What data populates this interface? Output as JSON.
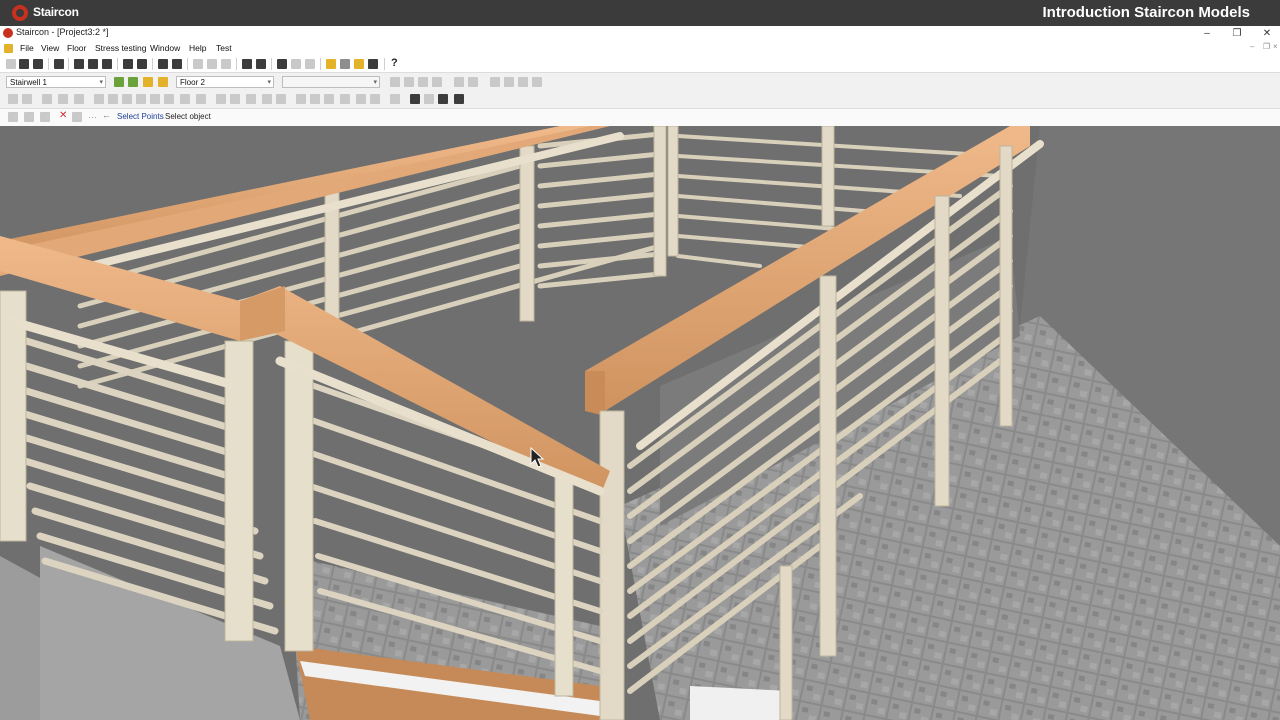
{
  "video": {
    "brand": "Staircon",
    "title": "Introduction Staircon Models"
  },
  "window": {
    "title": "Staircon - [Project3:2 *]",
    "minimize": "–",
    "restore": "❐",
    "close": "✕"
  },
  "menu": {
    "items": [
      "File",
      "View",
      "Floor",
      "Stress testing",
      "Window",
      "Help",
      "Test"
    ]
  },
  "toolbar": {
    "stairwell_select": "Stairwell 1",
    "floor_select": "Floor 2",
    "empty_select": ""
  },
  "status": {
    "select_points": "Select Points",
    "select_object": "Select object"
  },
  "icons": {
    "logo": "staircon-logo-icon",
    "help": "help-icon",
    "undo": "undo-icon",
    "redo": "redo-icon",
    "zoom": "zoom-icon",
    "cancel": "cancel-icon"
  },
  "colors": {
    "handrail": "#e0a774",
    "post": "#d9d1bd",
    "floor": "#7a7a7a",
    "brand": "#c8301f"
  }
}
